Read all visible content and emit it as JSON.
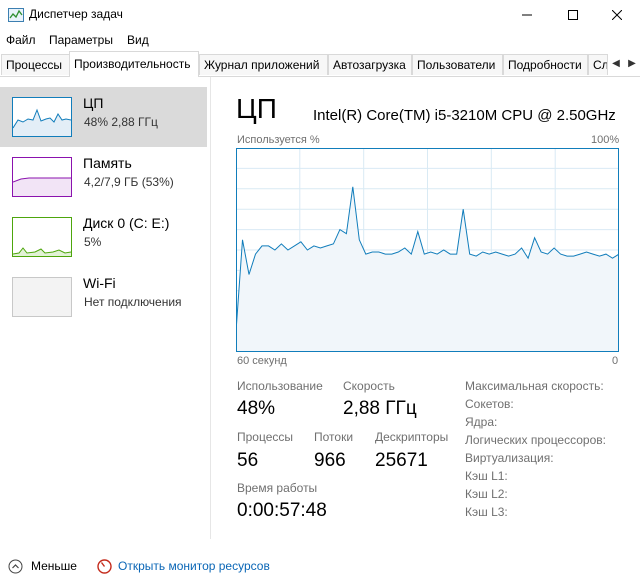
{
  "window": {
    "title": "Диспетчер задач",
    "minimize_icon": "minimize-icon",
    "maximize_icon": "maximize-icon",
    "close_icon": "close-icon"
  },
  "menu": [
    "Файл",
    "Параметры",
    "Вид"
  ],
  "tabs": [
    "Процессы",
    "Производительность",
    "Журнал приложений",
    "Автозагрузка",
    "Пользователи",
    "Подробности",
    "Сл"
  ],
  "active_tab": "Производительность",
  "sidebar": {
    "items": [
      {
        "name": "ЦП",
        "sub": "48% 2,88 ГГц",
        "color": "#117dbb"
      },
      {
        "name": "Память",
        "sub": "4,2/7,9 ГБ (53%)",
        "color": "#8b12ae"
      },
      {
        "name": "Диск 0 (C: E:)",
        "sub": "5%",
        "color": "#4da60c"
      },
      {
        "name": "Wi-Fi",
        "sub": "Нет подключения",
        "color": "#a7a7a7"
      }
    ]
  },
  "main": {
    "title": "ЦП",
    "cpu_model": "Intel(R) Core(TM) i5-3210M CPU @ 2.50GHz",
    "graph_label_left": "Используется %",
    "graph_label_right": "100%",
    "graph_time_left": "60 секунд",
    "graph_time_right": "0"
  },
  "stats": {
    "usage_label": "Использование",
    "usage_value": "48%",
    "speed_label": "Скорость",
    "speed_value": "2,88 ГГц",
    "processes_label": "Процессы",
    "processes_value": "56",
    "threads_label": "Потоки",
    "threads_value": "966",
    "handles_label": "Дескрипторы",
    "handles_value": "25671",
    "uptime_label": "Время работы",
    "uptime_value": "0:00:57:48"
  },
  "specs": [
    "Максимальная скорость:",
    "Сокетов:",
    "Ядра:",
    "Логических процессоров:",
    "Виртуализация:",
    "Кэш L1:",
    "Кэш L2:",
    "Кэш L3:"
  ],
  "footer": {
    "fewer_label": "Меньше",
    "monitor_link": "Открыть монитор ресурсов"
  },
  "colors": {
    "accent": "#117dbb",
    "graph_fill": "#f1f6fa",
    "graph_grid": "#d9eaf4",
    "link": "#0a66b6"
  },
  "chart_data": {
    "type": "area",
    "ylabel": "Используется %",
    "ylim": [
      0,
      100
    ],
    "x_label_left": "60 секунд",
    "x_label_right": "0",
    "values": [
      10,
      55,
      38,
      48,
      52,
      52,
      50,
      53,
      50,
      52,
      54,
      50,
      52,
      51,
      52,
      53,
      60,
      58,
      81,
      55,
      48,
      49,
      49,
      48,
      48,
      49,
      51,
      48,
      59,
      48,
      49,
      48,
      50,
      48,
      48,
      70,
      48,
      47,
      49,
      48,
      49,
      48,
      47,
      48,
      51,
      46,
      56,
      49,
      48,
      51,
      48,
      47,
      47,
      48,
      49,
      48,
      47,
      48,
      46,
      48
    ]
  }
}
